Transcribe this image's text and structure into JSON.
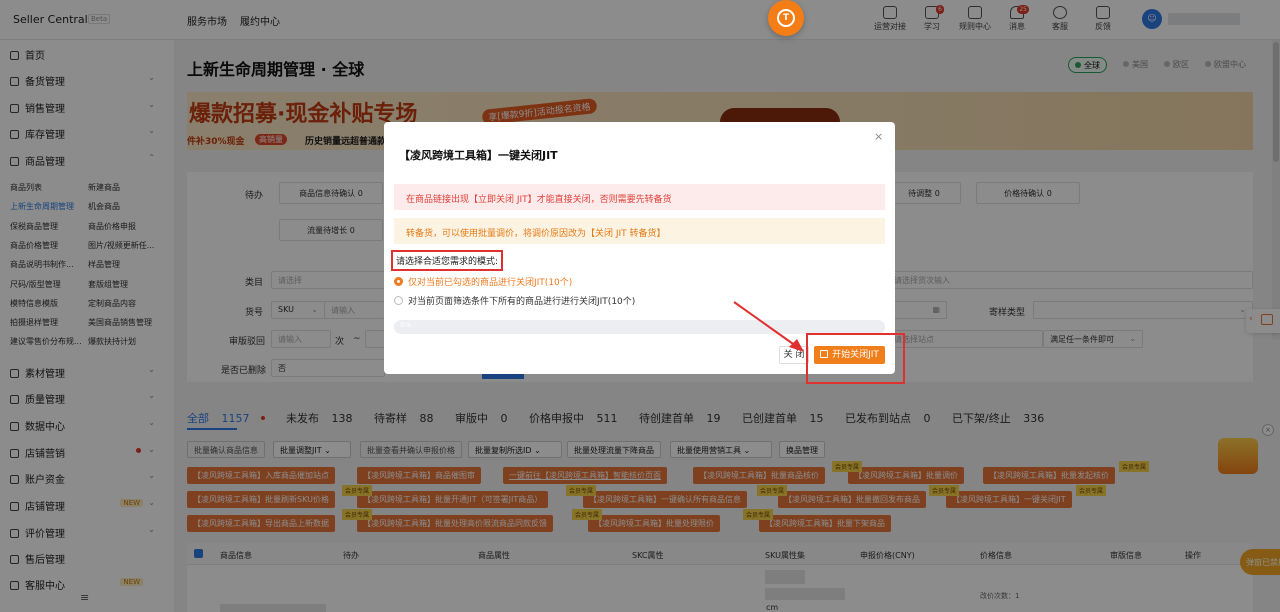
{
  "header": {
    "brand": "Seller Central",
    "beta": "Beta",
    "nav": [
      "服务市场",
      "履约中心"
    ],
    "tools": [
      {
        "label": "运营对接",
        "badge": ""
      },
      {
        "label": "学习",
        "badge": "6"
      },
      {
        "label": "规则中心",
        "badge": ""
      },
      {
        "label": "消息",
        "badge": "25"
      },
      {
        "label": "客服",
        "badge": ""
      },
      {
        "label": "反馈",
        "badge": ""
      }
    ],
    "fab_label": "T"
  },
  "sidebar": {
    "items_top": [
      {
        "label": "首页",
        "chevron": ""
      },
      {
        "label": "备货管理",
        "chevron": "⌄"
      },
      {
        "label": "销售管理",
        "chevron": "⌄"
      },
      {
        "label": "库存管理",
        "chevron": "⌄"
      },
      {
        "label": "商品管理",
        "chevron": "⌃"
      }
    ],
    "subitems": [
      [
        "商品列表",
        "新建商品"
      ],
      [
        "上新生命周期管理",
        "机会商品"
      ],
      [
        "保税商品管理",
        "商品价格申报"
      ],
      [
        "商品价格管理",
        "图片/视频更新任..."
      ],
      [
        "商品说明书制作...",
        "样品管理"
      ],
      [
        "尺码/版型管理",
        "套版组管理"
      ],
      [
        "模特信息模版",
        "定制商品内容"
      ],
      [
        "拍摄退样管理",
        "美国商品销售管理"
      ],
      [
        "建议零售价分布规...",
        "爆款扶持计划"
      ]
    ],
    "items_bottom": [
      {
        "label": "素材管理",
        "chevron": "⌄",
        "tag": ""
      },
      {
        "label": "质量管理",
        "chevron": "⌄",
        "tag": ""
      },
      {
        "label": "数据中心",
        "chevron": "⌄",
        "tag": ""
      },
      {
        "label": "店铺营销",
        "chevron": "⌄",
        "tag": "dot"
      },
      {
        "label": "账户资金",
        "chevron": "⌄",
        "tag": ""
      },
      {
        "label": "店铺管理",
        "chevron": "⌄",
        "tag": "NEW"
      },
      {
        "label": "评价管理",
        "chevron": "⌄",
        "tag": ""
      },
      {
        "label": "售后管理",
        "chevron": "",
        "tag": ""
      },
      {
        "label": "客服中心",
        "chevron": "",
        "tag": "NEW"
      }
    ],
    "collapse_icon": "≡"
  },
  "main": {
    "title": "上新生命周期管理 · 全球",
    "regions": [
      "全球",
      "美国",
      "欧区",
      "欧盟中心"
    ],
    "banner": {
      "headline": "爆款招募·现金补贴专场",
      "pill": "享[爆款9折]活动报名资格",
      "line_a": "件补30%现金",
      "line_b": "高销量",
      "line_c": "历史销量远超普通款"
    },
    "filters": {
      "todo_label": "待办",
      "todo_boxes": [
        "商品信息待确认 0",
        "待调整 0",
        "价格待确认 0"
      ],
      "todo_box2": "流量待增长 0",
      "cat_label": "类目",
      "cat_placeholder": "请选择",
      "sku_ph": "请选择货次输入",
      "sku_label": "货号",
      "sku_select": "SKU",
      "sku_input_ph": "请输入",
      "sample_label": "寄样类型",
      "audit_label": "审版驳回",
      "audit_input": "请输入",
      "audit_unit": "次",
      "audit_sep": "~",
      "site_ph": "请选择站点",
      "any_cond": "满足任一条件即可",
      "deleted_label": "是否已删除",
      "deleted_value": "否"
    },
    "tabs": [
      {
        "label": "全部",
        "count": "1157"
      },
      {
        "label": "未发布",
        "count": "138"
      },
      {
        "label": "待寄样",
        "count": "88"
      },
      {
        "label": "审版中",
        "count": "0"
      },
      {
        "label": "价格申报中",
        "count": "511"
      },
      {
        "label": "待创建首单",
        "count": "19"
      },
      {
        "label": "已创建首单",
        "count": "15"
      },
      {
        "label": "已发布到站点",
        "count": "0"
      },
      {
        "label": "已下架/终止",
        "count": "336"
      }
    ],
    "batch_buttons": [
      "批量确认商品信息",
      "批量调整JIT",
      "批量查看并确认申报价格",
      "批量复制所选ID",
      "批量处理流量下降商品",
      "批量使用营销工具",
      "换品管理"
    ],
    "tool_buttons": [
      "【凌风跨境工具箱】入库商品催加站点",
      "【凌风跨境工具箱】商品催图审",
      "一键前往【凌风跨境工具箱】智能核价页面",
      "【凌风跨境工具箱】批量商品核价",
      "【凌风跨境工具箱】批量调价",
      "【凌风跨境工具箱】批量发起核价",
      "【凌风跨境工具箱】批量刷新SKU价格",
      "【凌风跨境工具箱】批量开通JIT（可签署JIT商品）",
      "【凌风跨境工具箱】一键确认所有商品信息",
      "【凌风跨境工具箱】批量撤回发布商品",
      "【凌风跨境工具箱】一键关闭JIT",
      "【凌风跨境工具箱】导出商品上新数据",
      "【凌风跨境工具箱】批量处理高价限流商品同款反馈",
      "【凌风跨境工具箱】批量处理限价",
      "【凌风跨境工具箱】批量下架商品"
    ],
    "vip_tag": "会员专属",
    "table_headers": [
      "商品信息",
      "待办",
      "商品属性",
      "SKC属性",
      "SKU属性集",
      "申报价格(CNY)",
      "价格信息",
      "审版信息",
      "操作"
    ],
    "row_text": [
      "cm",
      "改价次数：1"
    ]
  },
  "modal": {
    "title": "【凌风跨境工具箱】一键关闭JIT",
    "alert_error": "在商品链接出现【立即关闭 JIT】才能直接关闭，否则需要先转备货",
    "alert_warning": "转备货，可以使用批量调价，将调价原因改为【关闭 JIT 转备货】",
    "mode_label": "请选择合适您需求的模式:",
    "options": [
      "仅对当前已勾选的商品进行关闭JIT(10个)",
      "对当前页面筛选条件下所有的商品进行进行关闭JIT(10个)"
    ],
    "selected_option": 0,
    "progress_percent": 0,
    "progress_text": "0%",
    "close_label": "关 闭",
    "start_label": "开始关闭JIT",
    "x_icon": "×"
  },
  "side": {
    "popup_btn": "弹窗已禁用",
    "promo_close": "×"
  },
  "colors": {
    "accent": "#2f7be5",
    "brand_orange": "#f07e1b",
    "danger": "#e03030"
  }
}
